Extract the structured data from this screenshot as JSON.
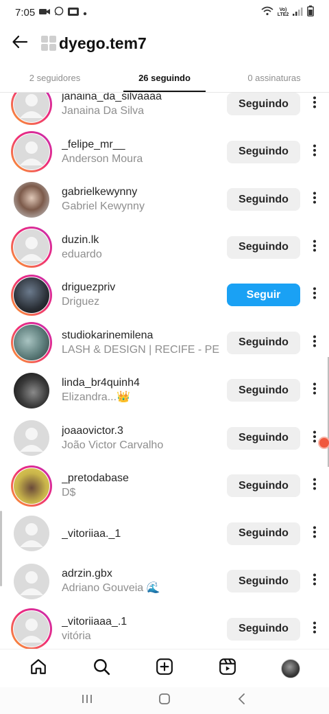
{
  "status_bar": {
    "time": "7:05",
    "network": "Vo) LTE2"
  },
  "header": {
    "title": "dyego.tem7"
  },
  "tabs": [
    {
      "label": "2 seguidores",
      "active": false
    },
    {
      "label": "26 seguindo",
      "active": true
    },
    {
      "label": "0 assinaturas",
      "active": false
    }
  ],
  "following_list": [
    {
      "username": "janaina_da_silvaaaa",
      "full_name": "Janaina Da Silva",
      "button": "Seguindo",
      "avatar": "default",
      "ring": true
    },
    {
      "username": "_felipe_mr__",
      "full_name": "Anderson Moura",
      "button": "Seguindo",
      "avatar": "default",
      "ring": true
    },
    {
      "username": "gabrielkewynny",
      "full_name": "Gabriel Kewynny",
      "button": "Seguindo",
      "avatar": "photo-street",
      "ring": false
    },
    {
      "username": "duzin.lk",
      "full_name": "eduardo",
      "button": "Seguindo",
      "avatar": "default",
      "ring": true
    },
    {
      "username": "driguezpriv",
      "full_name": "Driguez",
      "button": "Seguir",
      "avatar": "photo-dark",
      "ring": true
    },
    {
      "username": "studiokarinemilena",
      "full_name": "LASH & DESIGN | RECIFE - PE",
      "button": "Seguindo",
      "avatar": "photo-green",
      "ring": true
    },
    {
      "username": "linda_br4quinh4",
      "full_name": "Elizandra...👑",
      "button": "Seguindo",
      "avatar": "photo-bw",
      "ring": false
    },
    {
      "username": "joaaovictor.3",
      "full_name": "João Victor Carvalho",
      "button": "Seguindo",
      "avatar": "default",
      "ring": false
    },
    {
      "username": "_pretodabase",
      "full_name": "D$",
      "button": "Seguindo",
      "avatar": "photo-yellow",
      "ring": true
    },
    {
      "username": "_vitoriiaa._1",
      "full_name": "",
      "button": "Seguindo",
      "avatar": "default",
      "ring": false
    },
    {
      "username": "adrzin.gbx",
      "full_name": "Adriano Gouveia 🌊",
      "button": "Seguindo",
      "avatar": "default",
      "ring": false
    },
    {
      "username": "_vitoriiaaa_.1",
      "full_name": "vitória",
      "button": "Seguindo",
      "avatar": "default",
      "ring": true
    }
  ],
  "icons": {
    "back": "arrow-left-icon",
    "more": "more-vertical-icon",
    "home": "home-icon",
    "search": "search-icon",
    "create": "plus-square-icon",
    "reels": "reels-icon",
    "profile": "profile-avatar"
  },
  "colors": {
    "follow_button": "#1aa1f4",
    "following_button": "#efefef",
    "story_ring_start": "#f9a22b",
    "story_ring_end": "#c22fb6"
  }
}
